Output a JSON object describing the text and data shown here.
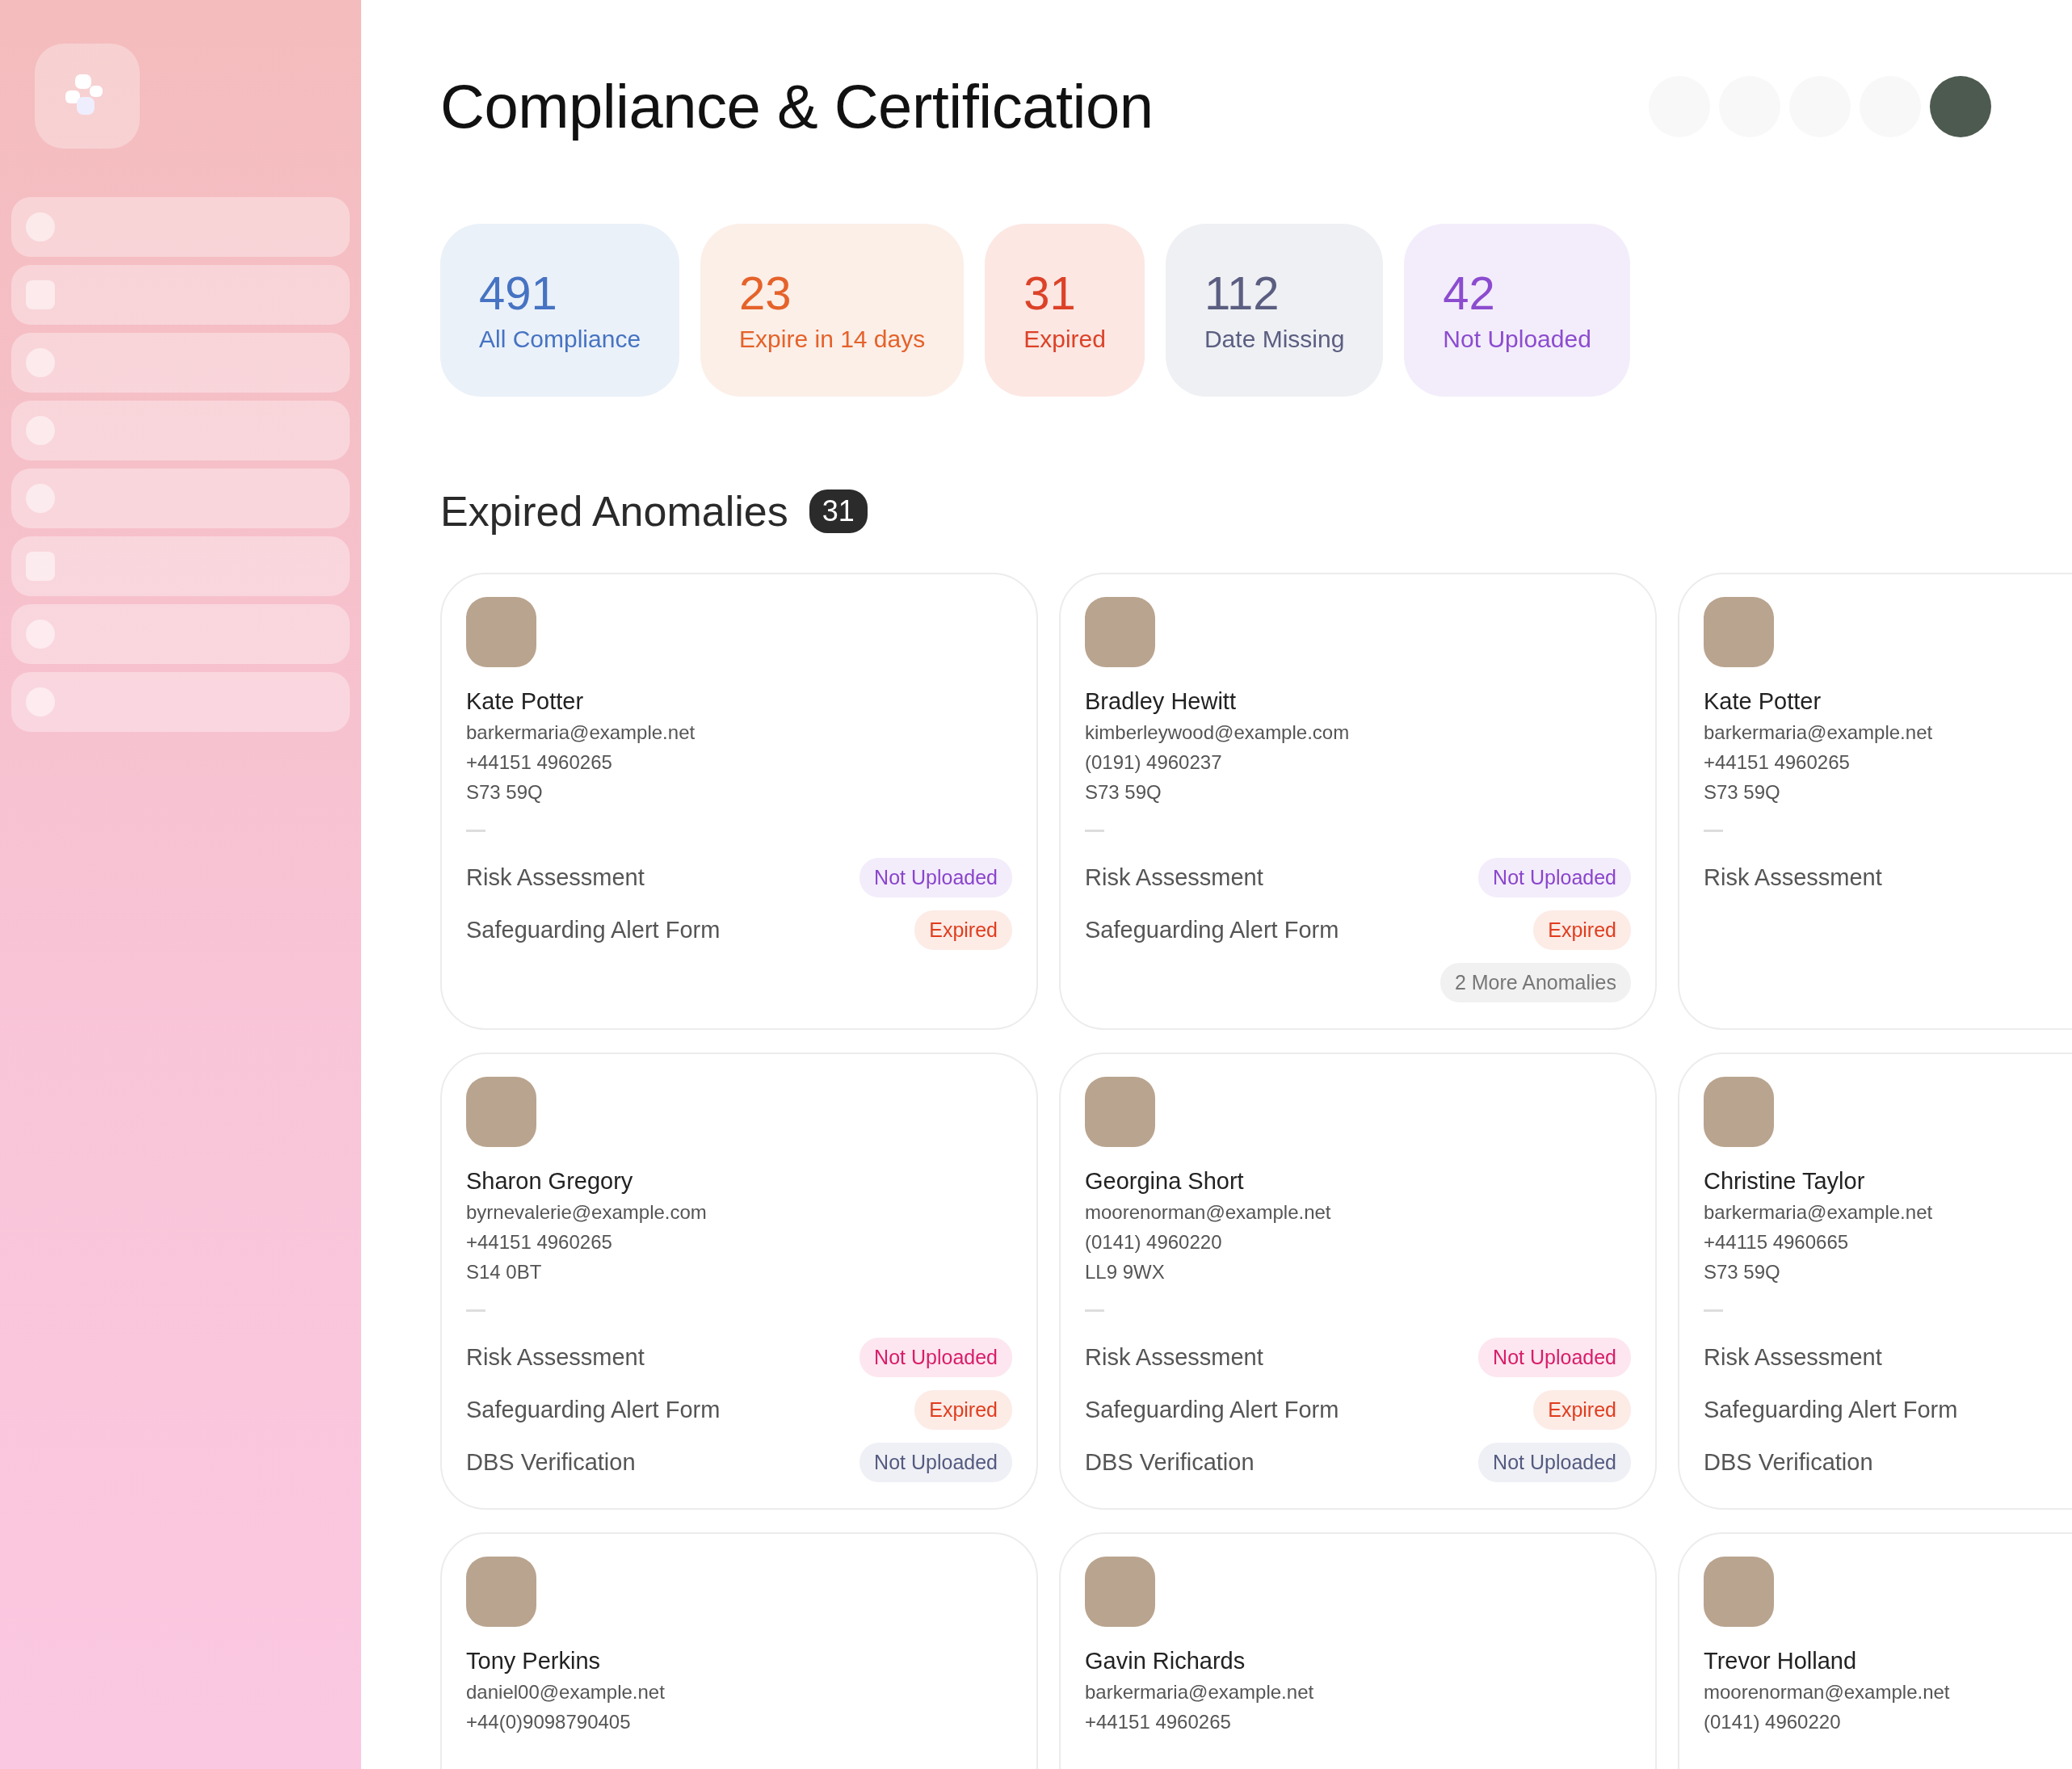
{
  "page": {
    "title": "Compliance & Certification"
  },
  "sidebar": {
    "items": [
      {
        "kind": "dot"
      },
      {
        "kind": "square"
      },
      {
        "kind": "dot"
      },
      {
        "kind": "dot"
      },
      {
        "kind": "dot"
      },
      {
        "kind": "square"
      },
      {
        "kind": "dot"
      },
      {
        "kind": "dot"
      }
    ]
  },
  "stats": [
    {
      "value": "491",
      "label": "All Compliance",
      "kind": "blue"
    },
    {
      "value": "23",
      "label": "Expire in 14 days",
      "kind": "orange"
    },
    {
      "value": "31",
      "label": "Expired",
      "kind": "red"
    },
    {
      "value": "112",
      "label": "Date Missing",
      "kind": "slate"
    },
    {
      "value": "42",
      "label": "Not Uploaded",
      "kind": "violet"
    }
  ],
  "section": {
    "title": "Expired Anomalies",
    "count": "31"
  },
  "cards": [
    {
      "name": "Kate Potter",
      "email": "barkermaria@example.net",
      "phone": "+44151 4960265",
      "postcode": "S73 59Q",
      "items": [
        {
          "label": "Risk Assessment",
          "badge": {
            "text": "Not Uploaded",
            "kind": "violet"
          }
        },
        {
          "label": "Safeguarding Alert Form",
          "badge": {
            "text": "Expired",
            "kind": "red"
          }
        }
      ]
    },
    {
      "name": "Bradley Hewitt",
      "email": "kimberleywood@example.com",
      "phone": "(0191) 4960237",
      "postcode": "S73 59Q",
      "items": [
        {
          "label": "Risk Assessment",
          "badge": {
            "text": "Not Uploaded",
            "kind": "violet"
          }
        },
        {
          "label": "Safeguarding Alert Form",
          "badge": {
            "text": "Expired",
            "kind": "red"
          }
        }
      ],
      "more": "2 More Anomalies"
    },
    {
      "name": "Kate Potter",
      "email": "barkermaria@example.net",
      "phone": "+44151 4960265",
      "postcode": "S73 59Q",
      "items": [
        {
          "label": "Risk Assessment"
        }
      ]
    },
    {
      "name": "Sharon Gregory",
      "email": "byrnevalerie@example.com",
      "phone": "+44151 4960265",
      "postcode": "S14 0BT",
      "items": [
        {
          "label": "Risk Assessment",
          "badge": {
            "text": "Not Uploaded",
            "kind": "pink"
          }
        },
        {
          "label": "Safeguarding Alert Form",
          "badge": {
            "text": "Expired",
            "kind": "red"
          }
        },
        {
          "label": "DBS Verification",
          "badge": {
            "text": "Not Uploaded",
            "kind": "slate"
          }
        }
      ]
    },
    {
      "name": "Georgina Short",
      "email": "moorenorman@example.net",
      "phone": "(0141) 4960220",
      "postcode": "LL9 9WX",
      "items": [
        {
          "label": "Risk Assessment",
          "badge": {
            "text": "Not Uploaded",
            "kind": "pink"
          }
        },
        {
          "label": "Safeguarding Alert Form",
          "badge": {
            "text": "Expired",
            "kind": "red"
          }
        },
        {
          "label": "DBS Verification",
          "badge": {
            "text": "Not Uploaded",
            "kind": "slate"
          }
        }
      ]
    },
    {
      "name": "Christine Taylor",
      "email": "barkermaria@example.net",
      "phone": "+44115 4960665",
      "postcode": "S73 59Q",
      "items": [
        {
          "label": "Risk Assessment"
        },
        {
          "label": "Safeguarding Alert Form"
        },
        {
          "label": "DBS Verification"
        }
      ]
    },
    {
      "name": "Tony Perkins",
      "email": "daniel00@example.net",
      "phone": "+44(0)9098790405"
    },
    {
      "name": "Gavin Richards",
      "email": "barkermaria@example.net",
      "phone": "+44151 4960265"
    },
    {
      "name": "Trevor Holland",
      "email": "moorenorman@example.net",
      "phone": "(0141) 4960220"
    }
  ]
}
